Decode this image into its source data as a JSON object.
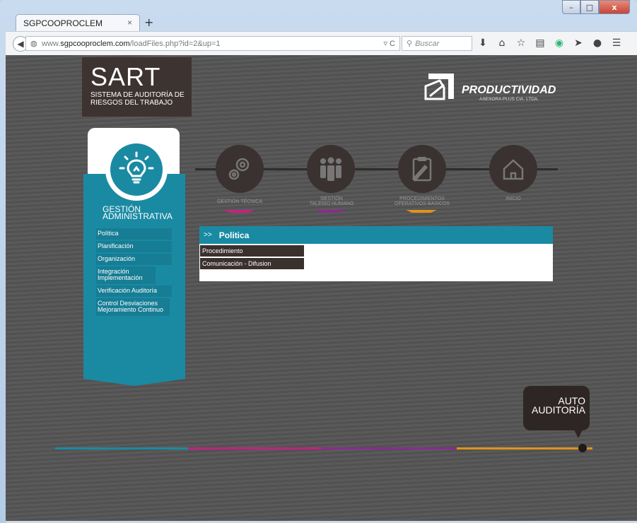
{
  "browser": {
    "tab_title": "SGPCOOPROCLEM",
    "tab_close": "×",
    "new_tab": "+",
    "url_prefix": "www.",
    "url_host": "sgpcooproclem.com",
    "url_path": "/loadFiles.php?id=2&up=1",
    "search_placeholder": "Buscar"
  },
  "window_controls": {
    "minimize": "–",
    "maximize": "□",
    "close": "x"
  },
  "logo": {
    "title": "SART",
    "subtitle_line1": "SISTEMA DE AUDITORÍA DE",
    "subtitle_line2": "RIESGOS DEL TRABAJO"
  },
  "brand": {
    "name": "PRODUCTIVIDAD",
    "sub": "ASESORA PLUS CIA. LTDA."
  },
  "sidebar": {
    "title_line1": "GESTIÓN",
    "title_line2": "ADMINISTRATIVA",
    "items": [
      "Política",
      "Planificación",
      "Organización",
      "Integración Implementación",
      "Verificación Auditoría",
      "Control Desviaciones Mejoramiento Continuo"
    ]
  },
  "nav": [
    {
      "label_line1": "GESTIÓN TÉCNICA",
      "label_line2": "",
      "color": "#c3227e"
    },
    {
      "label_line1": "GESTIÓN",
      "label_line2": "TALENIO HUMANO",
      "color": "#8a2b8f"
    },
    {
      "label_line1": "PROCEDIMIENTOS",
      "label_line2": "OPERATIVOS BASICOS",
      "color": "#e0931b"
    },
    {
      "label_line1": "INICIO",
      "label_line2": "",
      "color": ""
    }
  ],
  "panel": {
    "arrow": ">>",
    "title": "Politica",
    "items": [
      "Procedimiento",
      "Comunicación - Difusion"
    ]
  },
  "auto": {
    "line1": "AUTO",
    "line2": "AUDITORÍA"
  },
  "colors": {
    "teal": "#1a8aa3",
    "magenta": "#c3227e",
    "purple": "#8a2b8f",
    "orange": "#e0931b",
    "dark": "#3a302e"
  }
}
